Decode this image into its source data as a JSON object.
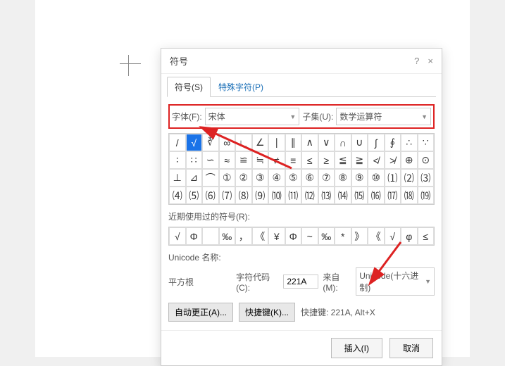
{
  "dialog": {
    "title": "符号",
    "help": "?",
    "close": "×",
    "tabs": {
      "symbols": "符号(S)",
      "special": "特殊字符(P)"
    },
    "font_label": "字体(F):",
    "font_value": "宋体",
    "subset_label": "子集(U):",
    "subset_value": "数学运算符",
    "grid": [
      [
        "/",
        "√",
        "∛",
        "∞",
        "∟",
        "∠",
        "∣",
        "∥",
        "∧",
        "∨",
        "∩",
        "∪",
        "∫",
        "∮",
        "∴",
        "∵"
      ],
      [
        "∶",
        "∷",
        "∽",
        "≈",
        "≌",
        "≒",
        "≠",
        "≡",
        "≤",
        "≥",
        "≦",
        "≧",
        "≮",
        "≯",
        "⊕",
        "⊙"
      ],
      [
        "⊥",
        "⊿",
        "⌒",
        "①",
        "②",
        "③",
        "④",
        "⑤",
        "⑥",
        "⑦",
        "⑧",
        "⑨",
        "⑩",
        "⑴",
        "⑵",
        "⑶"
      ],
      [
        "⑷",
        "⑸",
        "⑹",
        "⑺",
        "⑻",
        "⑼",
        "⑽",
        "⑾",
        "⑿",
        "⒀",
        "⒁",
        "⒂",
        "⒃",
        "⒄",
        "⒅",
        "⒆"
      ]
    ],
    "selected_row": 0,
    "selected_col": 1,
    "recent_label": "近期使用过的符号(R):",
    "recent": [
      "√",
      "Φ",
      "",
      "‰",
      "，",
      "《",
      "¥",
      "Φ",
      "~",
      "‰",
      "*",
      "》",
      "《",
      "√",
      "φ",
      "≤"
    ],
    "uname_label": "Unicode 名称:",
    "uname_value": "平方根",
    "code_label": "字符代码(C):",
    "code_value": "221A",
    "from_label": "来自(M):",
    "from_value": "Unicode(十六进制)",
    "autocorrect": "自动更正(A)...",
    "shortcutkey": "快捷键(K)...",
    "shortcut_text": "快捷键: 221A, Alt+X",
    "insert": "插入(I)",
    "cancel": "取消"
  }
}
